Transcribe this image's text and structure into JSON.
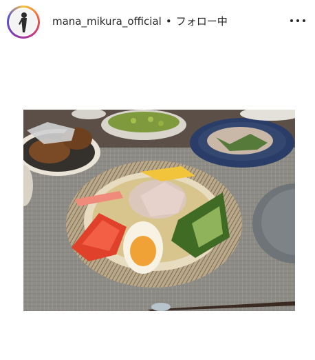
{
  "post_header": {
    "username": "mana_mikura_official",
    "separator": "•",
    "follow_status": "フォロー中",
    "more_icon": "ellipsis-icon"
  },
  "post_image": {
    "description_icon": "photo"
  }
}
